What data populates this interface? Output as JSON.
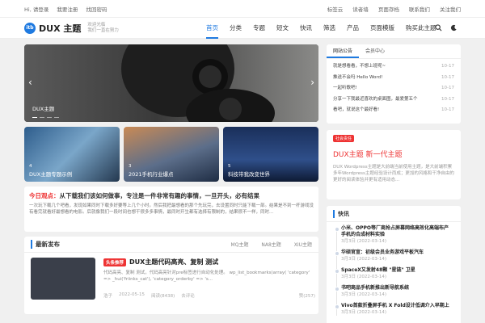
{
  "topbar": {
    "links": [
      "Hi, 请登录",
      "我要注册",
      "找回密码"
    ],
    "right": [
      "标签云",
      "读者墙",
      "页面存档",
      "联系我们",
      "关注我们"
    ]
  },
  "header": {
    "logo_mark": "itb",
    "logo_name": "DUX 主题",
    "tagline_1": "欢迎光临",
    "tagline_2": "我们一直在努力",
    "nav": [
      "首页",
      "分类",
      "专题",
      "短文",
      "快讯",
      "筛选",
      "产品",
      "页面模版",
      "购买此主题"
    ],
    "nav_active": 0
  },
  "slider": {
    "caption": "DUX主题"
  },
  "cards": [
    {
      "label": "DUX主题专题示例",
      "count": "4"
    },
    {
      "label": "2021手机行业爆点",
      "count": "3"
    },
    {
      "label": "科技带我改变世界",
      "count": "5"
    }
  ],
  "notice": {
    "label": "今日观点：",
    "title": "从下载我们该如何做事，专注是一件非常有趣的事情，一旦开头，必有结果",
    "body": "一次玩下载几个吧看，发现如果同时下载多好要等上几个小时。然后我把最想看的那个先玩完，去设置同时只能下载一部。结果是不到一杆游戏没有看完就看好最想看的电影。后就像我们一段时间也想干很多多事情，最同时开生都有选择有限制的，结果很不一样，同时..."
  },
  "latest": {
    "title": "最新发布",
    "tabs": [
      "MQ主题",
      "NA8主题",
      "XIU主题"
    ],
    "post": {
      "tag": "头条推荐",
      "title": "DUX主题代码高亮、复制 测试",
      "excerpt": "代码高亮、复制 测试，代码高亮针对pre标签进行自动化处理。 wp_list_bookmarks(array( 'category' => _hui('friinks_cat'), 'category_orderby' => 's...",
      "author": "浩子",
      "date": "2022-05-15",
      "views": "阅读(8438)",
      "comments": "去评论",
      "likes": "赞(257)"
    }
  },
  "announce": {
    "tabs": [
      "网站公告",
      "会员中心"
    ],
    "items": [
      {
        "title": "就是想看看，不想上班呢~",
        "date": "10-17"
      },
      {
        "title": "推送不会吗 Hello Word!",
        "date": "10-17"
      },
      {
        "title": "一起听歌吧!",
        "date": "10-17"
      },
      {
        "title": "分享一下我最近喜欢的桌面图，最爱第五个",
        "date": "10-17"
      },
      {
        "title": "看吧，就说这个最好看!",
        "date": "10-17"
      }
    ]
  },
  "promo": {
    "tag": "社会责任",
    "title": "DUX主题 新一代主题",
    "desc": "DUX Wordpress主题是大前端当前使用主题，是大前端积累多年Wordpress主题经验设计而成；更加的风格和干净自由的更好的阅读体验并更有适用动态..."
  },
  "news": {
    "title": "快讯",
    "items": [
      {
        "title": "小米、OPPO等厂商抢占屏幕网络高效化高端布产手机的合成材料实验",
        "date": "3月3日 (2022-03-14)"
      },
      {
        "title": "华硕官宣：初级会员业务游戏平板汽车",
        "date": "3月3日 (2022-03-14)"
      },
      {
        "title": "SpaceX又发射48颗 \"星链\" 卫星",
        "date": "3月3日 (2022-03-14)"
      },
      {
        "title": "书吧商品手机新推出新导航系统",
        "date": "3月3日 (2022-03-14)"
      },
      {
        "title": "Vivo首款折叠屏手机 X Fold设计低调介入早期上",
        "date": "3月3日 (2022-03-14)"
      }
    ]
  }
}
